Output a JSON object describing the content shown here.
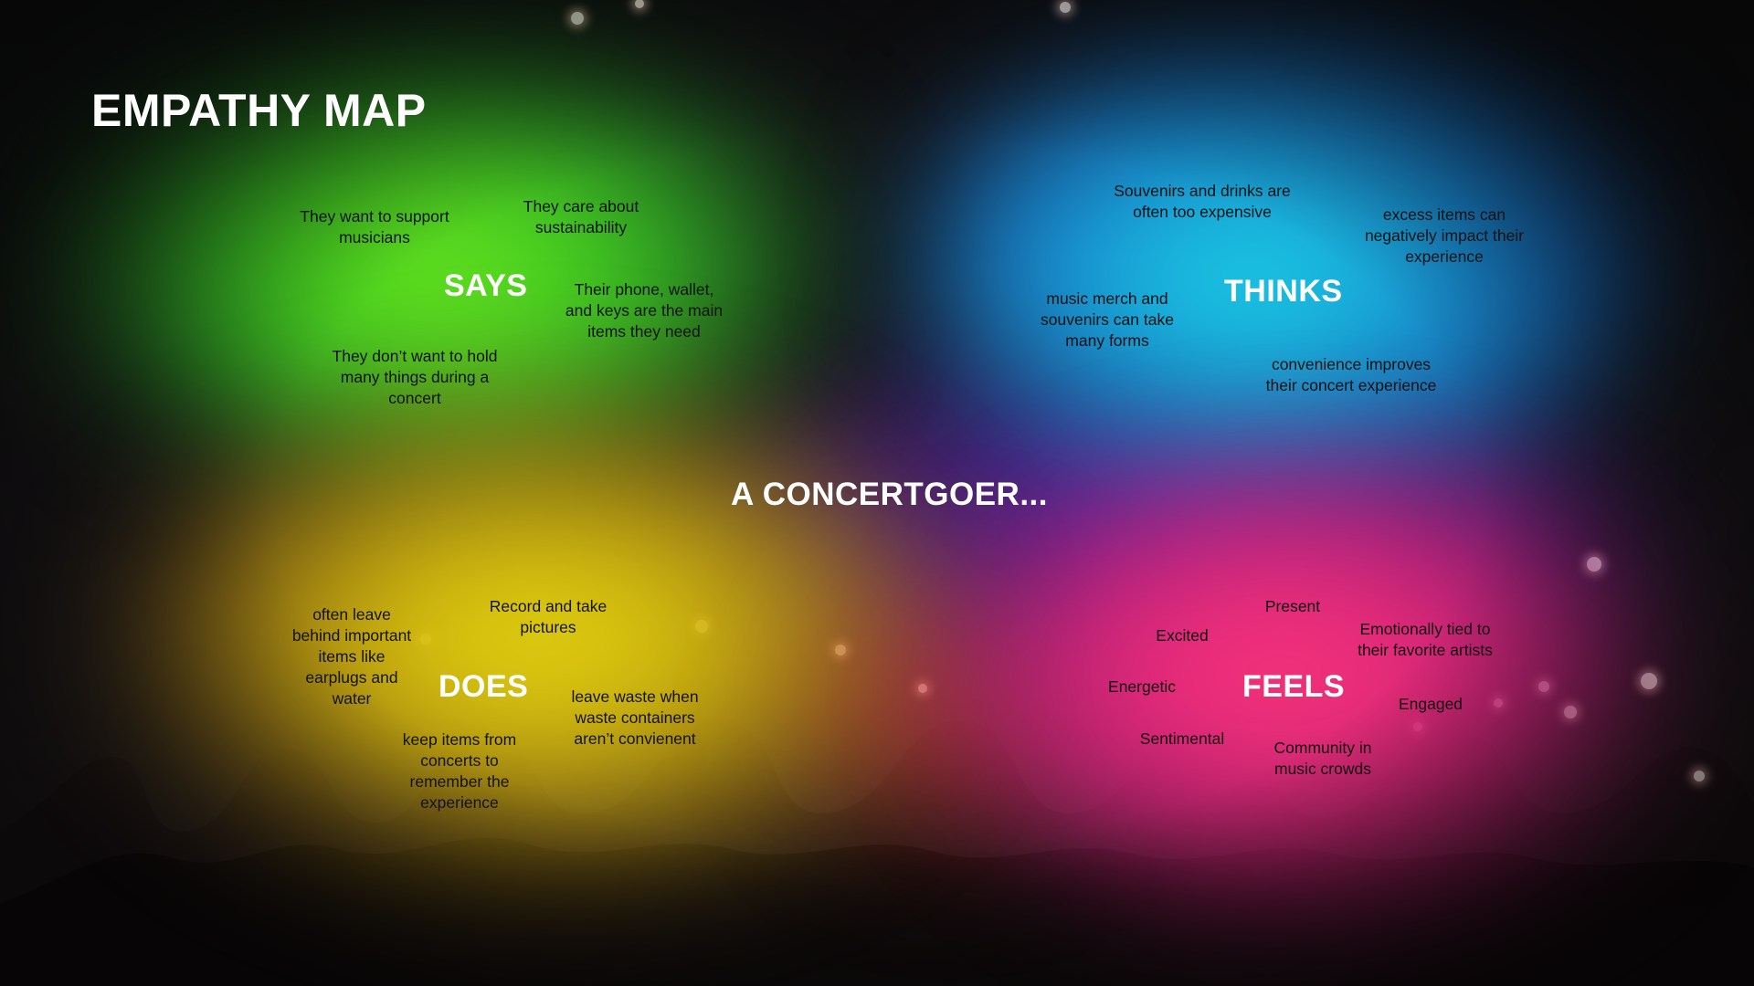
{
  "title": "EMPATHY MAP",
  "subject": "A CONCERTGOER...",
  "quadrants": {
    "says": {
      "label": "SAYS",
      "notes": [
        "They want to support\nmusicians",
        "They care about\nsustainability",
        "Their phone, wallet,\nand keys are the main\nitems they need",
        "They don’t want to hold\nmany things during a\nconcert"
      ]
    },
    "thinks": {
      "label": "THINKS",
      "notes": [
        "Souvenirs and drinks are\noften too expensive",
        "excess items can\nnegatively impact their\nexperience",
        "music merch and\nsouvenirs can take\nmany forms",
        "convenience improves\ntheir concert experience"
      ]
    },
    "does": {
      "label": "DOES",
      "notes": [
        "often leave\nbehind important\nitems like\nearplugs and\nwater",
        "Record and take\npictures",
        "leave waste when\nwaste containers\naren’t convienent",
        "keep items from\nconcerts to\nremember the\nexperience"
      ]
    },
    "feels": {
      "label": "FEELS",
      "notes": [
        "Present",
        "Excited",
        "Emotionally tied to\ntheir favorite artists",
        "Energetic",
        "Engaged",
        "Sentimental",
        "Community in\nmusic crowds"
      ]
    }
  },
  "colors": {
    "says": "#7cf01a",
    "thinks": "#19e6e6",
    "does": "#e8e012",
    "feels": "#ff3c7c",
    "center": "#6e28be"
  }
}
